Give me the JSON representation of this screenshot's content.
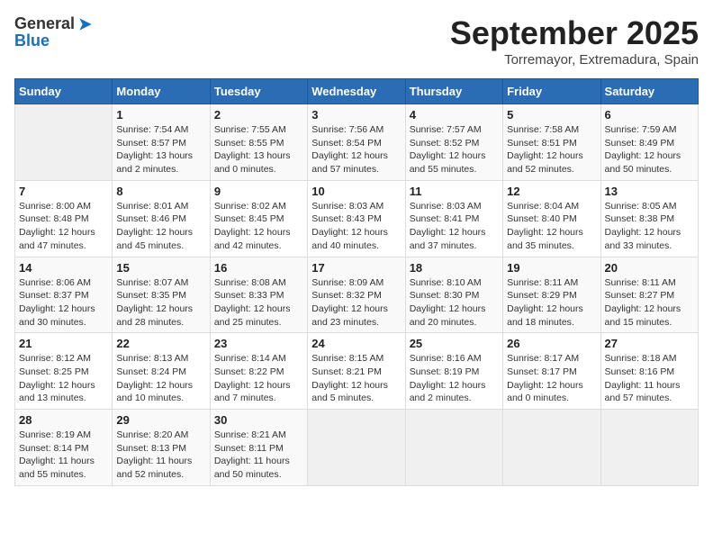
{
  "header": {
    "logo_general": "General",
    "logo_blue": "Blue",
    "month_title": "September 2025",
    "location": "Torremayor, Extremadura, Spain"
  },
  "weekdays": [
    "Sunday",
    "Monday",
    "Tuesday",
    "Wednesday",
    "Thursday",
    "Friday",
    "Saturday"
  ],
  "weeks": [
    [
      {
        "day": "",
        "sunrise": "",
        "sunset": "",
        "daylight": ""
      },
      {
        "day": "1",
        "sunrise": "Sunrise: 7:54 AM",
        "sunset": "Sunset: 8:57 PM",
        "daylight": "Daylight: 13 hours and 2 minutes."
      },
      {
        "day": "2",
        "sunrise": "Sunrise: 7:55 AM",
        "sunset": "Sunset: 8:55 PM",
        "daylight": "Daylight: 13 hours and 0 minutes."
      },
      {
        "day": "3",
        "sunrise": "Sunrise: 7:56 AM",
        "sunset": "Sunset: 8:54 PM",
        "daylight": "Daylight: 12 hours and 57 minutes."
      },
      {
        "day": "4",
        "sunrise": "Sunrise: 7:57 AM",
        "sunset": "Sunset: 8:52 PM",
        "daylight": "Daylight: 12 hours and 55 minutes."
      },
      {
        "day": "5",
        "sunrise": "Sunrise: 7:58 AM",
        "sunset": "Sunset: 8:51 PM",
        "daylight": "Daylight: 12 hours and 52 minutes."
      },
      {
        "day": "6",
        "sunrise": "Sunrise: 7:59 AM",
        "sunset": "Sunset: 8:49 PM",
        "daylight": "Daylight: 12 hours and 50 minutes."
      }
    ],
    [
      {
        "day": "7",
        "sunrise": "Sunrise: 8:00 AM",
        "sunset": "Sunset: 8:48 PM",
        "daylight": "Daylight: 12 hours and 47 minutes."
      },
      {
        "day": "8",
        "sunrise": "Sunrise: 8:01 AM",
        "sunset": "Sunset: 8:46 PM",
        "daylight": "Daylight: 12 hours and 45 minutes."
      },
      {
        "day": "9",
        "sunrise": "Sunrise: 8:02 AM",
        "sunset": "Sunset: 8:45 PM",
        "daylight": "Daylight: 12 hours and 42 minutes."
      },
      {
        "day": "10",
        "sunrise": "Sunrise: 8:03 AM",
        "sunset": "Sunset: 8:43 PM",
        "daylight": "Daylight: 12 hours and 40 minutes."
      },
      {
        "day": "11",
        "sunrise": "Sunrise: 8:03 AM",
        "sunset": "Sunset: 8:41 PM",
        "daylight": "Daylight: 12 hours and 37 minutes."
      },
      {
        "day": "12",
        "sunrise": "Sunrise: 8:04 AM",
        "sunset": "Sunset: 8:40 PM",
        "daylight": "Daylight: 12 hours and 35 minutes."
      },
      {
        "day": "13",
        "sunrise": "Sunrise: 8:05 AM",
        "sunset": "Sunset: 8:38 PM",
        "daylight": "Daylight: 12 hours and 33 minutes."
      }
    ],
    [
      {
        "day": "14",
        "sunrise": "Sunrise: 8:06 AM",
        "sunset": "Sunset: 8:37 PM",
        "daylight": "Daylight: 12 hours and 30 minutes."
      },
      {
        "day": "15",
        "sunrise": "Sunrise: 8:07 AM",
        "sunset": "Sunset: 8:35 PM",
        "daylight": "Daylight: 12 hours and 28 minutes."
      },
      {
        "day": "16",
        "sunrise": "Sunrise: 8:08 AM",
        "sunset": "Sunset: 8:33 PM",
        "daylight": "Daylight: 12 hours and 25 minutes."
      },
      {
        "day": "17",
        "sunrise": "Sunrise: 8:09 AM",
        "sunset": "Sunset: 8:32 PM",
        "daylight": "Daylight: 12 hours and 23 minutes."
      },
      {
        "day": "18",
        "sunrise": "Sunrise: 8:10 AM",
        "sunset": "Sunset: 8:30 PM",
        "daylight": "Daylight: 12 hours and 20 minutes."
      },
      {
        "day": "19",
        "sunrise": "Sunrise: 8:11 AM",
        "sunset": "Sunset: 8:29 PM",
        "daylight": "Daylight: 12 hours and 18 minutes."
      },
      {
        "day": "20",
        "sunrise": "Sunrise: 8:11 AM",
        "sunset": "Sunset: 8:27 PM",
        "daylight": "Daylight: 12 hours and 15 minutes."
      }
    ],
    [
      {
        "day": "21",
        "sunrise": "Sunrise: 8:12 AM",
        "sunset": "Sunset: 8:25 PM",
        "daylight": "Daylight: 12 hours and 13 minutes."
      },
      {
        "day": "22",
        "sunrise": "Sunrise: 8:13 AM",
        "sunset": "Sunset: 8:24 PM",
        "daylight": "Daylight: 12 hours and 10 minutes."
      },
      {
        "day": "23",
        "sunrise": "Sunrise: 8:14 AM",
        "sunset": "Sunset: 8:22 PM",
        "daylight": "Daylight: 12 hours and 7 minutes."
      },
      {
        "day": "24",
        "sunrise": "Sunrise: 8:15 AM",
        "sunset": "Sunset: 8:21 PM",
        "daylight": "Daylight: 12 hours and 5 minutes."
      },
      {
        "day": "25",
        "sunrise": "Sunrise: 8:16 AM",
        "sunset": "Sunset: 8:19 PM",
        "daylight": "Daylight: 12 hours and 2 minutes."
      },
      {
        "day": "26",
        "sunrise": "Sunrise: 8:17 AM",
        "sunset": "Sunset: 8:17 PM",
        "daylight": "Daylight: 12 hours and 0 minutes."
      },
      {
        "day": "27",
        "sunrise": "Sunrise: 8:18 AM",
        "sunset": "Sunset: 8:16 PM",
        "daylight": "Daylight: 11 hours and 57 minutes."
      }
    ],
    [
      {
        "day": "28",
        "sunrise": "Sunrise: 8:19 AM",
        "sunset": "Sunset: 8:14 PM",
        "daylight": "Daylight: 11 hours and 55 minutes."
      },
      {
        "day": "29",
        "sunrise": "Sunrise: 8:20 AM",
        "sunset": "Sunset: 8:13 PM",
        "daylight": "Daylight: 11 hours and 52 minutes."
      },
      {
        "day": "30",
        "sunrise": "Sunrise: 8:21 AM",
        "sunset": "Sunset: 8:11 PM",
        "daylight": "Daylight: 11 hours and 50 minutes."
      },
      {
        "day": "",
        "sunrise": "",
        "sunset": "",
        "daylight": ""
      },
      {
        "day": "",
        "sunrise": "",
        "sunset": "",
        "daylight": ""
      },
      {
        "day": "",
        "sunrise": "",
        "sunset": "",
        "daylight": ""
      },
      {
        "day": "",
        "sunrise": "",
        "sunset": "",
        "daylight": ""
      }
    ]
  ]
}
